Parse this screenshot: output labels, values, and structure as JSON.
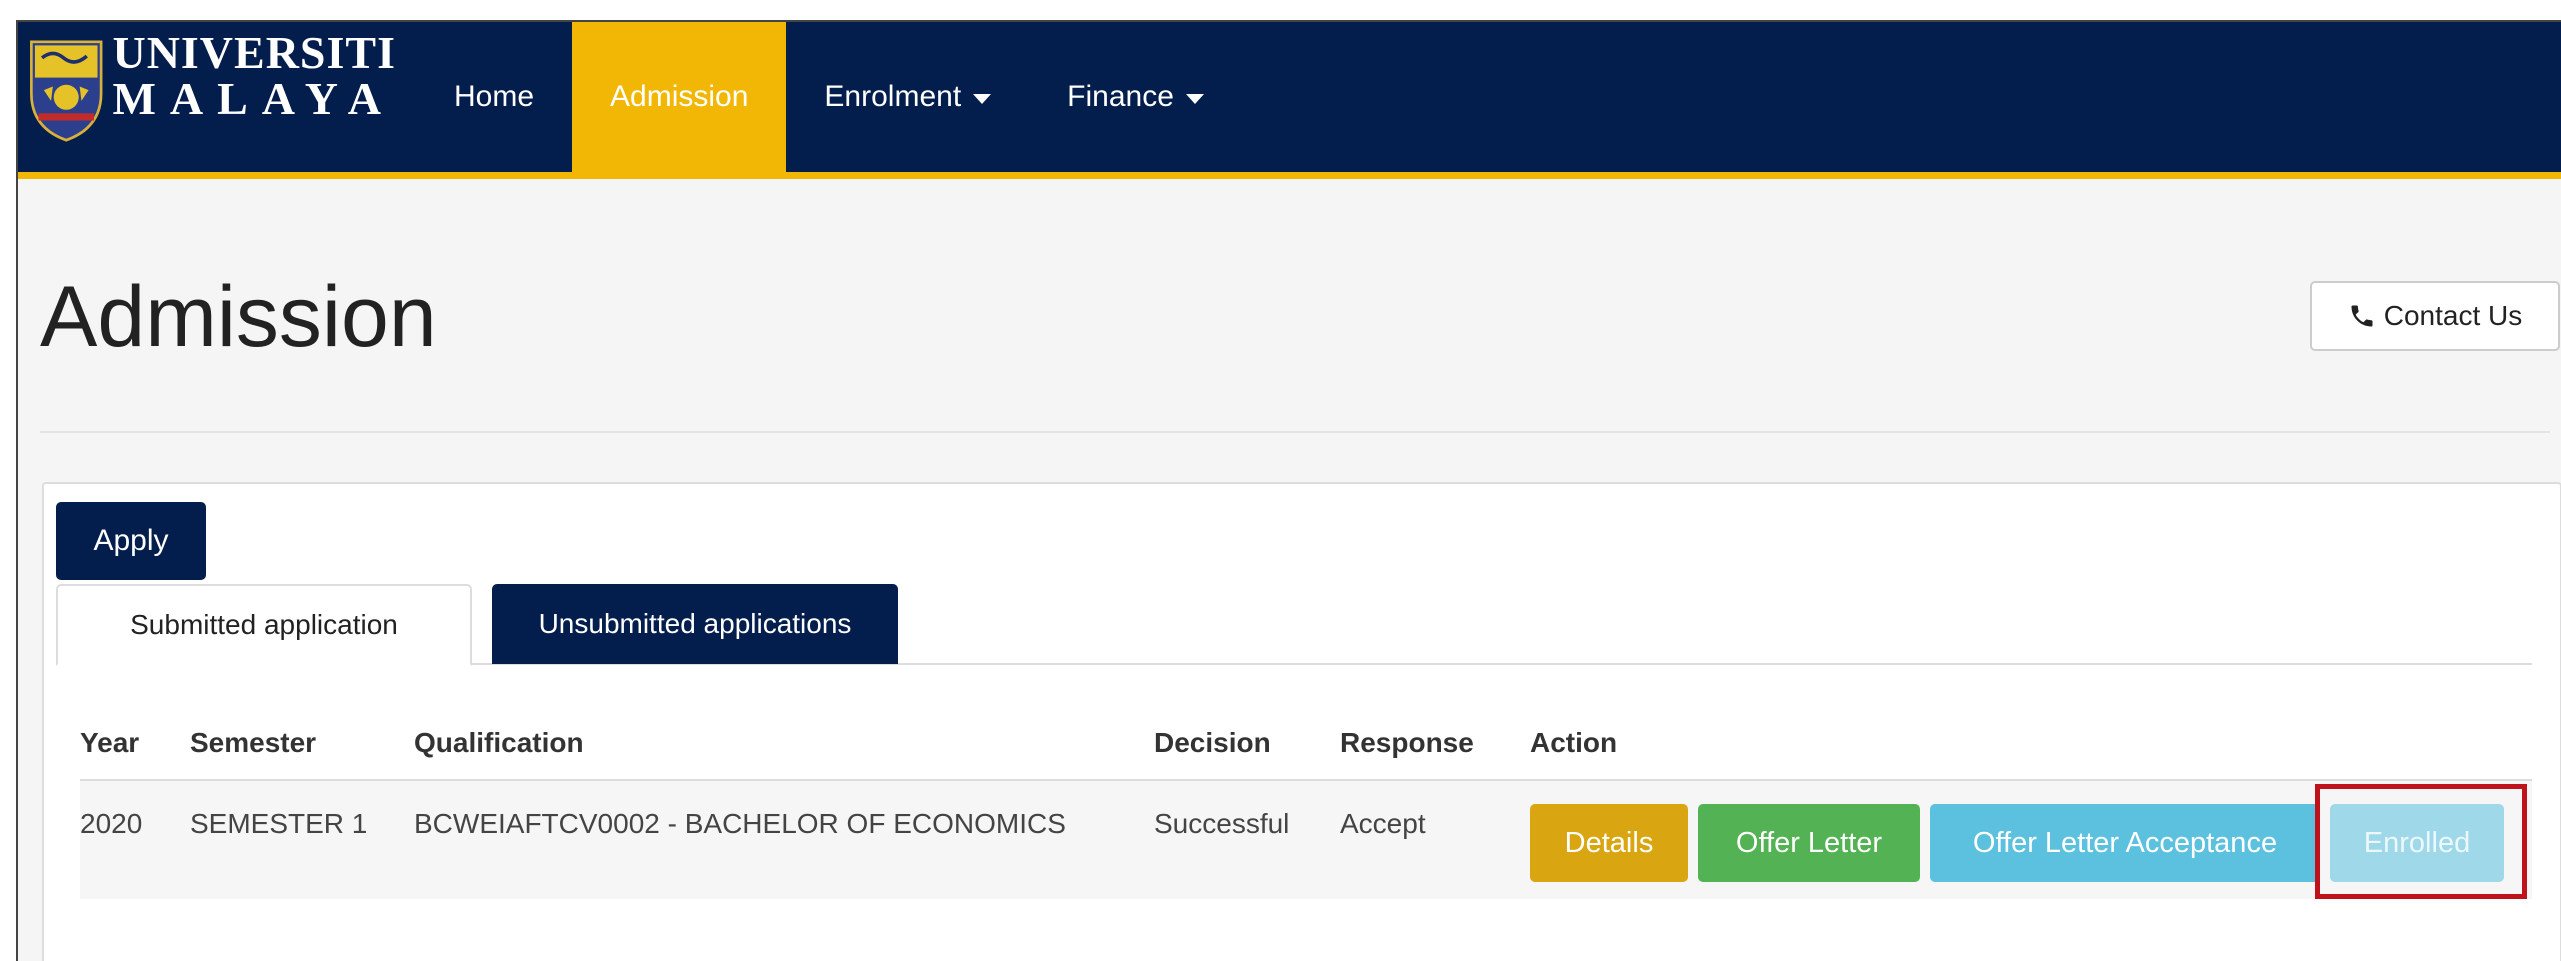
{
  "brand": {
    "line1": "UNIVERSITI",
    "line2": "MALAYA",
    "logo_icon": "university-crest-icon"
  },
  "nav": {
    "items": [
      {
        "label": "Home",
        "active": false,
        "dropdown": false
      },
      {
        "label": "Admission",
        "active": true,
        "dropdown": false
      },
      {
        "label": "Enrolment",
        "active": false,
        "dropdown": true
      },
      {
        "label": "Finance",
        "active": false,
        "dropdown": true
      }
    ]
  },
  "colors": {
    "navbar": "#031d4c",
    "accent": "#f2b705",
    "details_button": "#d9a612",
    "offer_letter_button": "#53b253",
    "acceptance_button": "#5cc1df",
    "enrolled_button": "#9fd8e8",
    "highlight_border": "#c0121a"
  },
  "page": {
    "title": "Admission",
    "contact_label": "Contact Us",
    "contact_icon": "phone-icon"
  },
  "panel": {
    "apply_label": "Apply",
    "tabs": [
      {
        "label": "Submitted application",
        "active": true
      },
      {
        "label": "Unsubmitted applications",
        "active": false
      }
    ]
  },
  "table": {
    "headers": [
      "Year",
      "Semester",
      "Qualification",
      "Decision",
      "Response",
      "Action"
    ],
    "rows": [
      {
        "year": "2020",
        "semester": "SEMESTER 1",
        "qualification": "BCWEIAFTCV0002 - BACHELOR OF ECONOMICS",
        "decision": "Successful",
        "response": "Accept",
        "actions": [
          "Details",
          "Offer Letter",
          "Offer Letter Acceptance",
          "Enrolled"
        ]
      }
    ]
  }
}
